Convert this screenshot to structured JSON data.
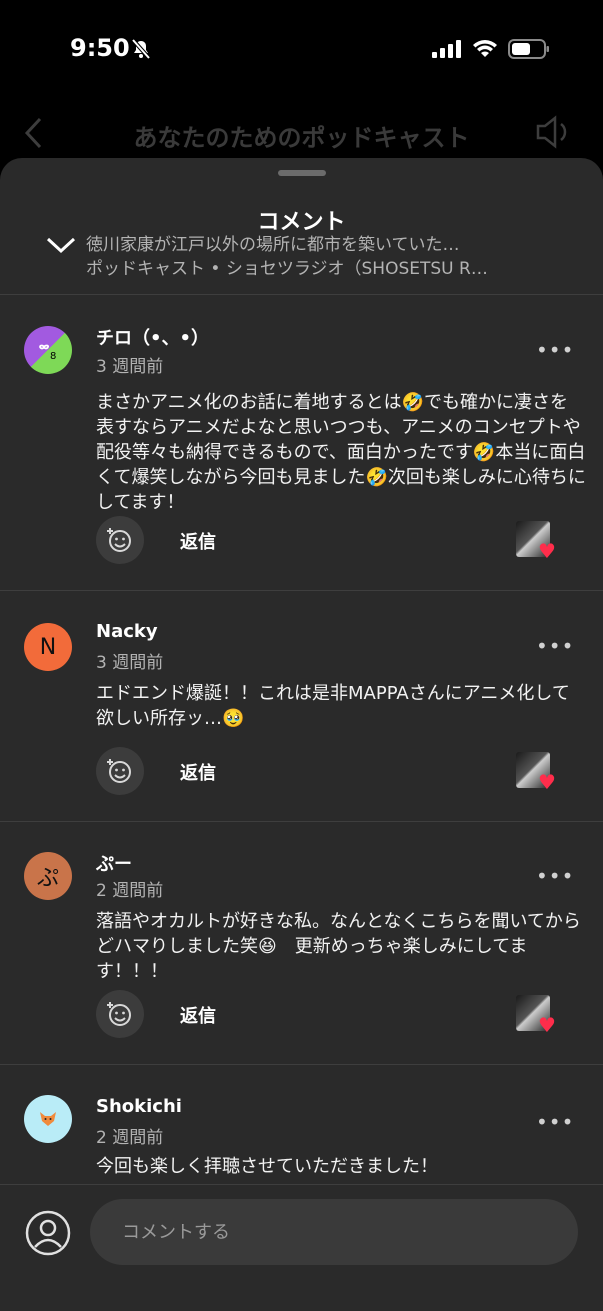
{
  "status_bar": {
    "time": "9:50"
  },
  "header": {
    "title": "あなたのためのポッドキャスト"
  },
  "sheet": {
    "title": "コメント",
    "episode_title": "徳川家康が江戸以外の場所に都市を築いていた…",
    "episode_subtitle": "ポッドキャスト • ショセツラジオ（SHOSETSU R…"
  },
  "comments": [
    {
      "username": "チロ（•、•）",
      "time_ago": "3 週間前",
      "text": "まさかアニメ化のお話に着地するとは🤣でも確かに凄さを表すならアニメだよなと思いつつも、アニメのコンセプトや配役等々も納得できるもので、面白かったです🤣本当に面白くて爆笑しながら今回も見ました🤣次回も楽しみに心待ちにしてます！",
      "reply_label": "返信",
      "more": "•••"
    },
    {
      "username": "Nacky",
      "avatar_letter": "N",
      "time_ago": "3 週間前",
      "text": "エドエンド爆誕！！これは是非MAPPAさんにアニメ化して欲しい所存ッ…🥹",
      "reply_label": "返信",
      "more": "•••"
    },
    {
      "username": "ぷー",
      "avatar_letter": "ぷ",
      "time_ago": "2 週間前",
      "text": "落語やオカルトが好きな私。なんとなくこちらを聞いてからどハマりしました笑😆　更新めっちゃ楽しみにしてます！！！",
      "reply_label": "返信",
      "more": "•••"
    },
    {
      "username": "Shokichi",
      "time_ago": "2 週間前",
      "text": "今回も楽しく拝聴させていただきました！",
      "more": "•••"
    }
  ],
  "composer": {
    "placeholder": "コメントする"
  },
  "colors": {
    "sheet_bg": "#2a2a2a",
    "avatar_n": "#f26b3a",
    "avatar_pu": "#c9744a",
    "heart": "#ff2d4b"
  }
}
